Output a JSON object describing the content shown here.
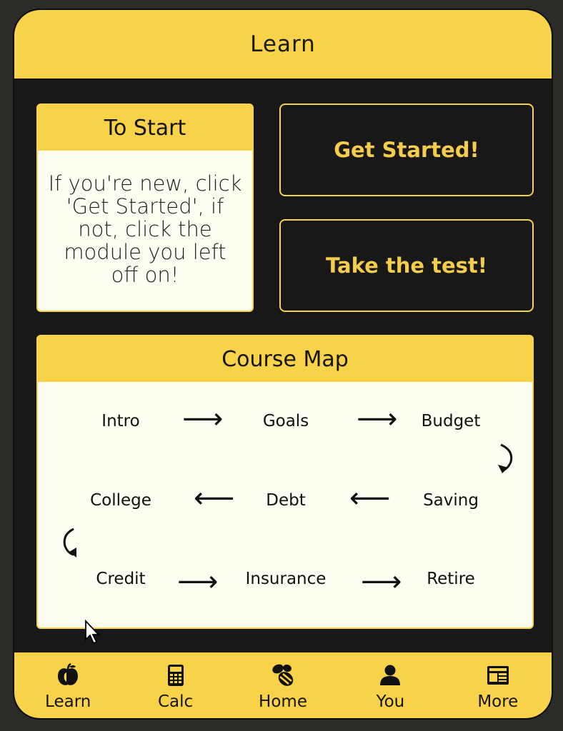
{
  "header": {
    "title": "Learn"
  },
  "intro": {
    "heading": "To Start",
    "text": "If you're new, click 'Get Started', if not, click the module you left off on!"
  },
  "actions": {
    "get_started": "Get Started!",
    "take_test": "Take the test!"
  },
  "course_map": {
    "heading": "Course Map",
    "modules": [
      "Intro",
      "Goals",
      "Budget",
      "College",
      "Debt",
      "Saving",
      "Credit",
      "Insurance",
      "Retire"
    ]
  },
  "nav": {
    "items": [
      {
        "label": "Learn",
        "icon": "apple-icon"
      },
      {
        "label": "Calc",
        "icon": "calculator-icon"
      },
      {
        "label": "Home",
        "icon": "bee-icon"
      },
      {
        "label": "You",
        "icon": "user-icon"
      },
      {
        "label": "More",
        "icon": "news-icon"
      }
    ]
  },
  "colors": {
    "accent": "#f8d34a",
    "background": "#181818",
    "card": "#fdfdf1"
  }
}
